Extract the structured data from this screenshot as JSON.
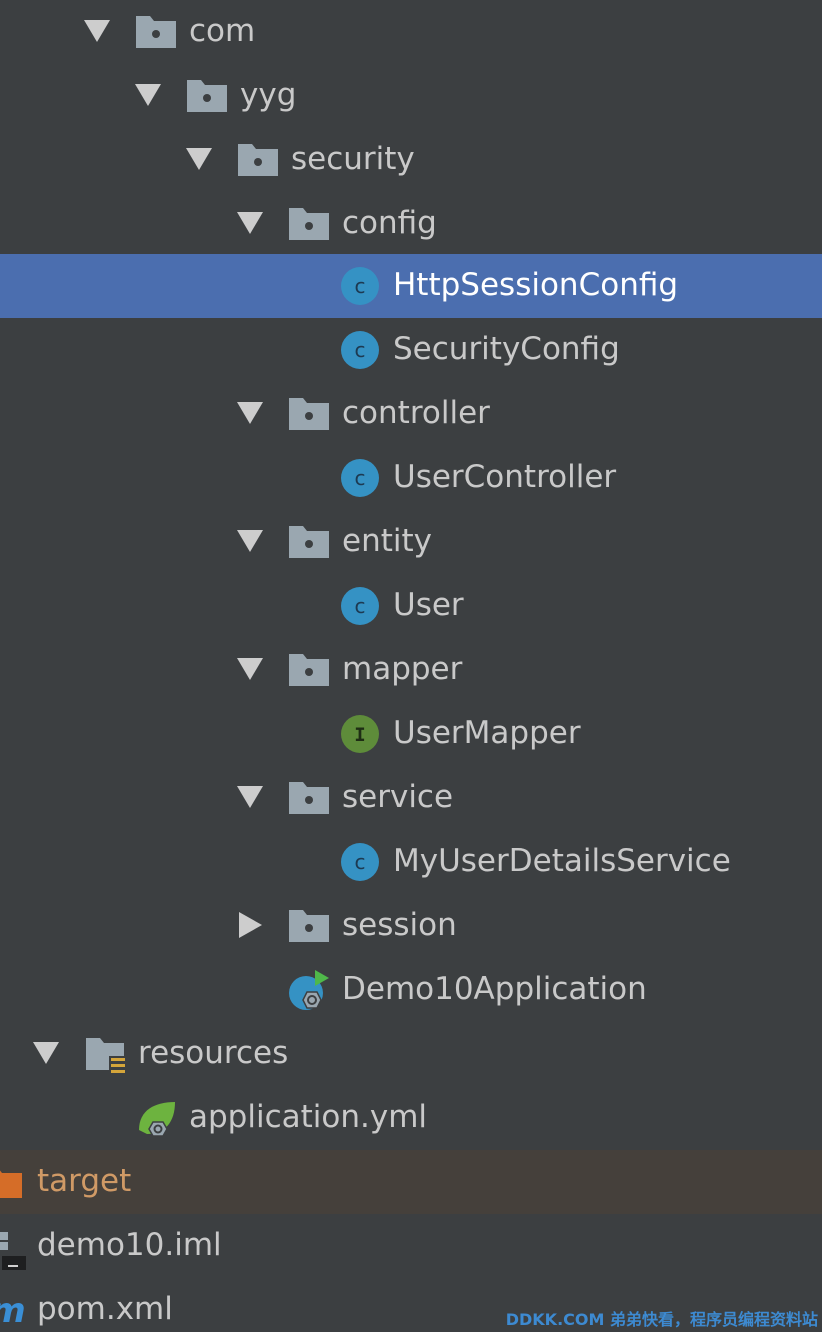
{
  "tree": {
    "nodes": [
      {
        "label": "com",
        "kind": "package",
        "expanded": true
      },
      {
        "label": "yyg",
        "kind": "package",
        "expanded": true
      },
      {
        "label": "security",
        "kind": "package",
        "expanded": true
      },
      {
        "label": "config",
        "kind": "package",
        "expanded": true
      },
      {
        "label": "HttpSessionConfig",
        "kind": "class",
        "selected": true
      },
      {
        "label": "SecurityConfig",
        "kind": "class"
      },
      {
        "label": "controller",
        "kind": "package",
        "expanded": true
      },
      {
        "label": "UserController",
        "kind": "class"
      },
      {
        "label": "entity",
        "kind": "package",
        "expanded": true
      },
      {
        "label": "User",
        "kind": "class"
      },
      {
        "label": "mapper",
        "kind": "package",
        "expanded": true
      },
      {
        "label": "UserMapper",
        "kind": "interface"
      },
      {
        "label": "service",
        "kind": "package",
        "expanded": true
      },
      {
        "label": "MyUserDetailsService",
        "kind": "class"
      },
      {
        "label": "session",
        "kind": "package",
        "expanded": false
      },
      {
        "label": "Demo10Application",
        "kind": "spring-boot-app"
      },
      {
        "label": "resources",
        "kind": "resources-folder",
        "expanded": true
      },
      {
        "label": "application.yml",
        "kind": "spring-yml"
      },
      {
        "label": "target",
        "kind": "excluded-folder"
      },
      {
        "label": "demo10.iml",
        "kind": "iml-file"
      },
      {
        "label": "pom.xml",
        "kind": "maven-file"
      }
    ]
  },
  "icons": {
    "class": "class-c-icon",
    "interface": "interface-i-icon",
    "package": "package-folder-icon"
  },
  "colors": {
    "background": "#3c3f41",
    "selection": "#4b6eaf",
    "class_icon": "#3592c4",
    "interface_icon": "#5e8c3a",
    "folder_icon": "#9aa7b0",
    "excluded_folder": "#d56d28"
  },
  "watermark": "DDKK.COM 弟弟快看，程序员编程资料站"
}
